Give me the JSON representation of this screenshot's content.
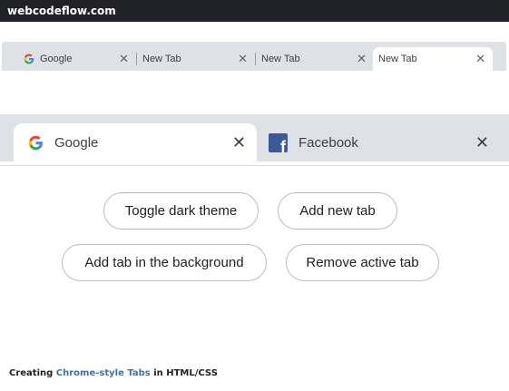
{
  "site": {
    "title": "webcodeflow.com"
  },
  "small_tabs": [
    {
      "title": "Google",
      "icon": "google-g-icon",
      "close": "✕"
    },
    {
      "title": "New Tab",
      "close": "✕"
    },
    {
      "title": "New Tab",
      "close": "✕"
    },
    {
      "title": "New Tab",
      "close": "✕",
      "active": true
    }
  ],
  "large_tabs": [
    {
      "title": "Google",
      "icon": "google-g-icon",
      "close": "✕",
      "active": true
    },
    {
      "title": "Facebook",
      "icon": "facebook-icon",
      "icon_glyph": "f",
      "close": "✕"
    }
  ],
  "buttons": {
    "toggle_dark": "Toggle dark theme",
    "add_new_tab": "Add new tab",
    "add_background": "Add tab in the background",
    "remove_active": "Remove active tab"
  },
  "footer": {
    "prefix": "Creating ",
    "highlight": "Chrome-style Tabs",
    "suffix": " in HTML/CSS"
  },
  "colors": {
    "tab_strip": "#dee1e6",
    "topbar": "#202124",
    "facebook": "#3b5998",
    "footer_highlight": "#3b6fb6"
  }
}
